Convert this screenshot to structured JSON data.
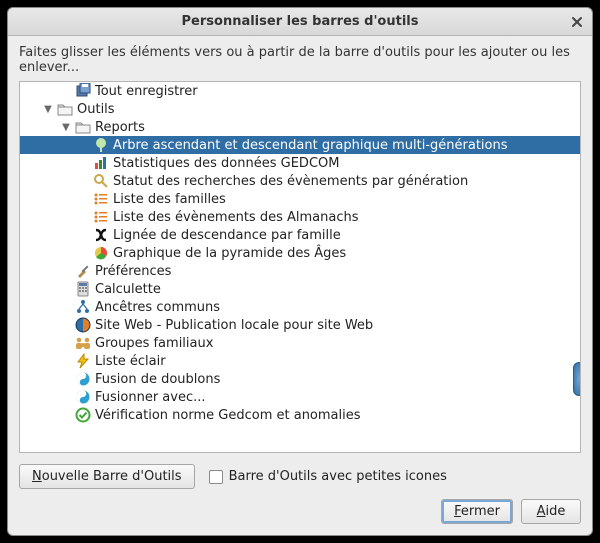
{
  "window": {
    "title": "Personnaliser les barres d'outils"
  },
  "instructions": "Faites glisser les éléments vers ou à partir de la barre d'outils pour les ajouter ou les enlever...",
  "tree": [
    {
      "depth": 2,
      "expander": "none",
      "icon": "save-all",
      "label": "Tout enregistrer",
      "selected": false
    },
    {
      "depth": 1,
      "expander": "open",
      "icon": "folder",
      "label": "Outils",
      "selected": false
    },
    {
      "depth": 2,
      "expander": "open",
      "icon": "folder",
      "label": "Reports",
      "selected": false
    },
    {
      "depth": 3,
      "expander": "none",
      "icon": "tree",
      "label": "Arbre ascendant et descendant graphique multi-générations",
      "selected": true
    },
    {
      "depth": 3,
      "expander": "none",
      "icon": "stats",
      "label": "Statistiques des données GEDCOM",
      "selected": false
    },
    {
      "depth": 3,
      "expander": "none",
      "icon": "magnifier",
      "label": "Statut des recherches des évènements par génération",
      "selected": false
    },
    {
      "depth": 3,
      "expander": "none",
      "icon": "list-orange",
      "label": "Liste des familles",
      "selected": false
    },
    {
      "depth": 3,
      "expander": "none",
      "icon": "list-orange",
      "label": "Liste des évènements des Almanachs",
      "selected": false
    },
    {
      "depth": 3,
      "expander": "none",
      "icon": "lineage",
      "label": "Lignée de descendance par famille",
      "selected": false
    },
    {
      "depth": 3,
      "expander": "none",
      "icon": "pie",
      "label": "Graphique de la pyramide des Âges",
      "selected": false
    },
    {
      "depth": 2,
      "expander": "none",
      "icon": "prefs",
      "label": "Préférences",
      "selected": false
    },
    {
      "depth": 2,
      "expander": "none",
      "icon": "calc",
      "label": "Calculette",
      "selected": false
    },
    {
      "depth": 2,
      "expander": "none",
      "icon": "ancestors",
      "label": "Ancêtres communs",
      "selected": false
    },
    {
      "depth": 2,
      "expander": "none",
      "icon": "globe",
      "label": "Site Web - Publication locale pour site Web",
      "selected": false
    },
    {
      "depth": 2,
      "expander": "none",
      "icon": "family",
      "label": "Groupes familiaux",
      "selected": false
    },
    {
      "depth": 2,
      "expander": "none",
      "icon": "flash",
      "label": "Liste éclair",
      "selected": false
    },
    {
      "depth": 2,
      "expander": "none",
      "icon": "merge",
      "label": "Fusion de doublons",
      "selected": false
    },
    {
      "depth": 2,
      "expander": "none",
      "icon": "merge",
      "label": "Fusionner avec...",
      "selected": false
    },
    {
      "depth": 2,
      "expander": "none",
      "icon": "check-green",
      "label": "Vérification norme Gedcom et anomalies",
      "selected": false
    }
  ],
  "lower": {
    "new_toolbar_button": "Nouvelle Barre d'Outils",
    "small_icons_checkbox": "Barre d'Outils avec petites icones",
    "small_icons_checked": false
  },
  "footer": {
    "close": "Fermer",
    "help": "Aide"
  },
  "icons_semantic": {
    "save-all": "stacked floppy disks",
    "folder": "folder",
    "tree": "green tree",
    "stats": "colored bar chart",
    "magnifier": "magnifying glass",
    "list-orange": "orange bullet list",
    "lineage": "black S-curve",
    "pie": "pie chart",
    "prefs": "wrench/screwdriver",
    "calc": "calculator",
    "ancestors": "blue nodes",
    "globe": "firefox globe",
    "family": "three people",
    "flash": "yellow lightning bolt",
    "merge": "blue yin-yang",
    "check-green": "green checkmark circle"
  }
}
